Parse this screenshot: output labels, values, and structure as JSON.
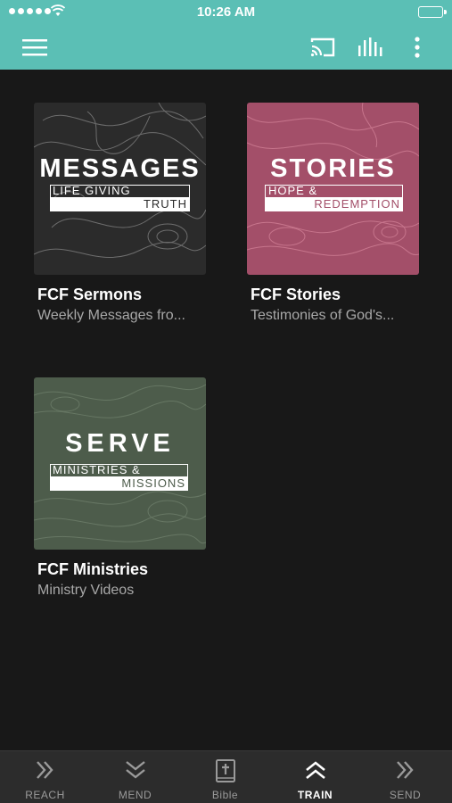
{
  "status_bar": {
    "time": "10:26 AM"
  },
  "app_bar": {
    "accent_color": "#5bbfb5",
    "icons": [
      "menu-icon",
      "cast-icon",
      "equalizer-icon",
      "more-vert-icon"
    ]
  },
  "cards": [
    {
      "art_title": "MESSAGES",
      "art_line1": "LIFE GIVING",
      "art_line2": "TRUTH",
      "title": "FCF Sermons",
      "subtitle": "Weekly Messages fro...",
      "color": "#2b2b2b"
    },
    {
      "art_title": "STORIES",
      "art_line1": "HOPE &",
      "art_line2": "REDEMPTION",
      "title": "FCF Stories",
      "subtitle": "Testimonies of God's...",
      "color": "#a34f69"
    },
    {
      "art_title": "SERVE",
      "art_line1": "MINISTRIES &",
      "art_line2": "MISSIONS",
      "title": "FCF Ministries",
      "subtitle": "Ministry Videos",
      "color": "#4d5c4b"
    }
  ],
  "bottom_nav": {
    "items": [
      {
        "label": "REACH",
        "icon": "double-chevron-right-icon",
        "active": false
      },
      {
        "label": "MEND",
        "icon": "double-chevron-down-icon",
        "active": false
      },
      {
        "label": "Bible",
        "icon": "bible-icon",
        "active": false
      },
      {
        "label": "TRAIN",
        "icon": "double-chevron-up-icon",
        "active": true
      },
      {
        "label": "SEND",
        "icon": "double-chevron-right-icon",
        "active": false
      }
    ]
  }
}
